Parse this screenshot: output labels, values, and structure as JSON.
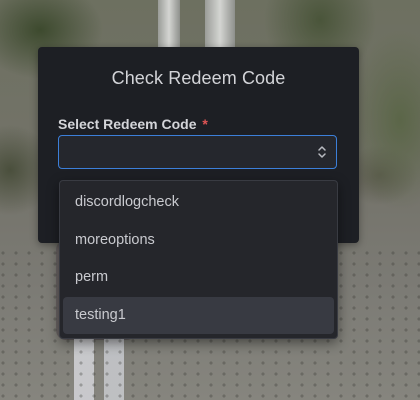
{
  "dialog": {
    "title": "Check Redeem Code",
    "field_label": "Select Redeem Code",
    "required_mark": "*",
    "selected_value": ""
  },
  "dropdown": {
    "items": [
      {
        "label": "discordlogcheck",
        "highlighted": false
      },
      {
        "label": "moreoptions",
        "highlighted": false
      },
      {
        "label": "perm",
        "highlighted": false
      },
      {
        "label": "testing1",
        "highlighted": true
      }
    ]
  },
  "icons": {
    "select": "chevron-up-down-icon"
  },
  "colors": {
    "dialog_bg": "#1d1f24",
    "input_border_focus": "#3c7fd9",
    "required": "#e05555",
    "highlight_bg": "#383a42"
  }
}
